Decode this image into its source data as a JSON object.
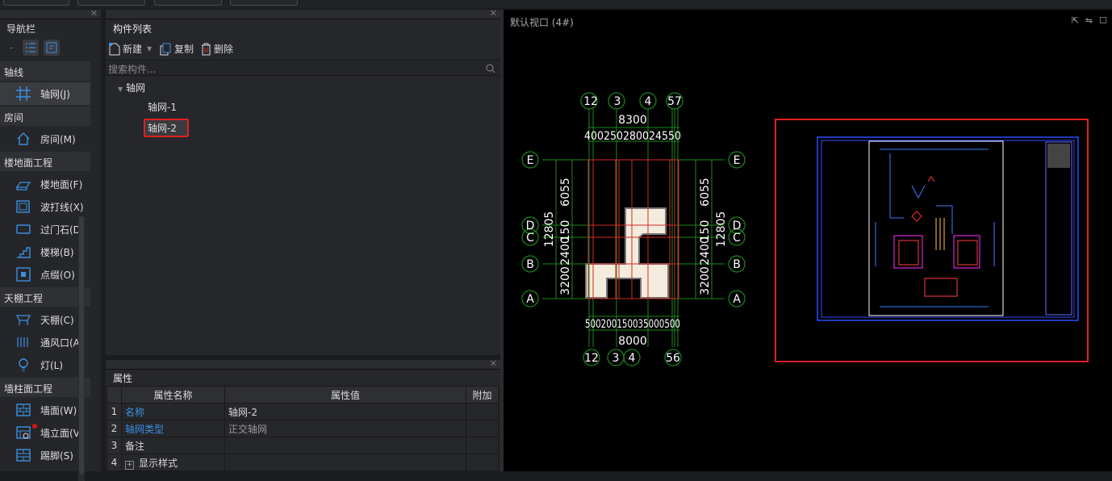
{
  "nav": {
    "title": "导航栏",
    "groups": [
      {
        "label": "轴线",
        "items": [
          {
            "label": "轴网(J)",
            "icon": "grid-icon",
            "selected": true
          }
        ]
      },
      {
        "label": "房间",
        "items": [
          {
            "label": "房间(M)",
            "icon": "house-icon"
          }
        ]
      },
      {
        "label": "楼地面工程",
        "items": [
          {
            "label": "楼地面(F)",
            "icon": "floor-icon"
          },
          {
            "label": "波打线(X)",
            "icon": "border-line-icon"
          },
          {
            "label": "过门石(D)",
            "icon": "threshold-icon"
          },
          {
            "label": "楼梯(B)",
            "icon": "stairs-icon"
          },
          {
            "label": "点缀(O)",
            "icon": "ornament-icon"
          }
        ]
      },
      {
        "label": "天棚工程",
        "items": [
          {
            "label": "天棚(C)",
            "icon": "ceiling-icon"
          },
          {
            "label": "通风口(A)",
            "icon": "vent-icon"
          },
          {
            "label": "灯(L)",
            "icon": "lamp-icon"
          }
        ]
      },
      {
        "label": "墙柱面工程",
        "items": [
          {
            "label": "墙面(W)",
            "icon": "wall-icon"
          },
          {
            "label": "墙立面(V)",
            "icon": "wall-elevation-icon"
          },
          {
            "label": "踢脚(S)",
            "icon": "skirting-icon"
          }
        ]
      }
    ]
  },
  "components": {
    "title": "构件列表",
    "new_label": "新建",
    "copy_label": "复制",
    "delete_label": "删除",
    "search_placeholder": "搜索构件...",
    "tree": {
      "root": "轴网",
      "children": [
        "轴网-1",
        "轴网-2"
      ],
      "selected": "轴网-2"
    }
  },
  "properties": {
    "title": "属性",
    "headers": [
      "属性名称",
      "属性值",
      "附加"
    ],
    "rows": [
      {
        "n": "1",
        "name": "名称",
        "value": "轴网-2"
      },
      {
        "n": "2",
        "name": "轴网类型",
        "value": "正交轴网"
      },
      {
        "n": "3",
        "name": "备注",
        "value": ""
      },
      {
        "n": "4",
        "name": "显示样式",
        "value": ""
      }
    ]
  },
  "viewport": {
    "title": "默认视口 (4#)",
    "top_axes": [
      "12",
      "3",
      "4",
      "57"
    ],
    "bottom_axes": [
      "12",
      "3",
      "4",
      "56"
    ],
    "row_axes": [
      "E",
      "D",
      "C",
      "B",
      "A"
    ],
    "top_total": "8300",
    "top_dims": "400250280024550",
    "bottom_total": "8000",
    "bottom_dims": "500200150035000500",
    "side_total": "12805",
    "side_dims": [
      "6055",
      "150",
      "2400",
      "3200"
    ]
  }
}
